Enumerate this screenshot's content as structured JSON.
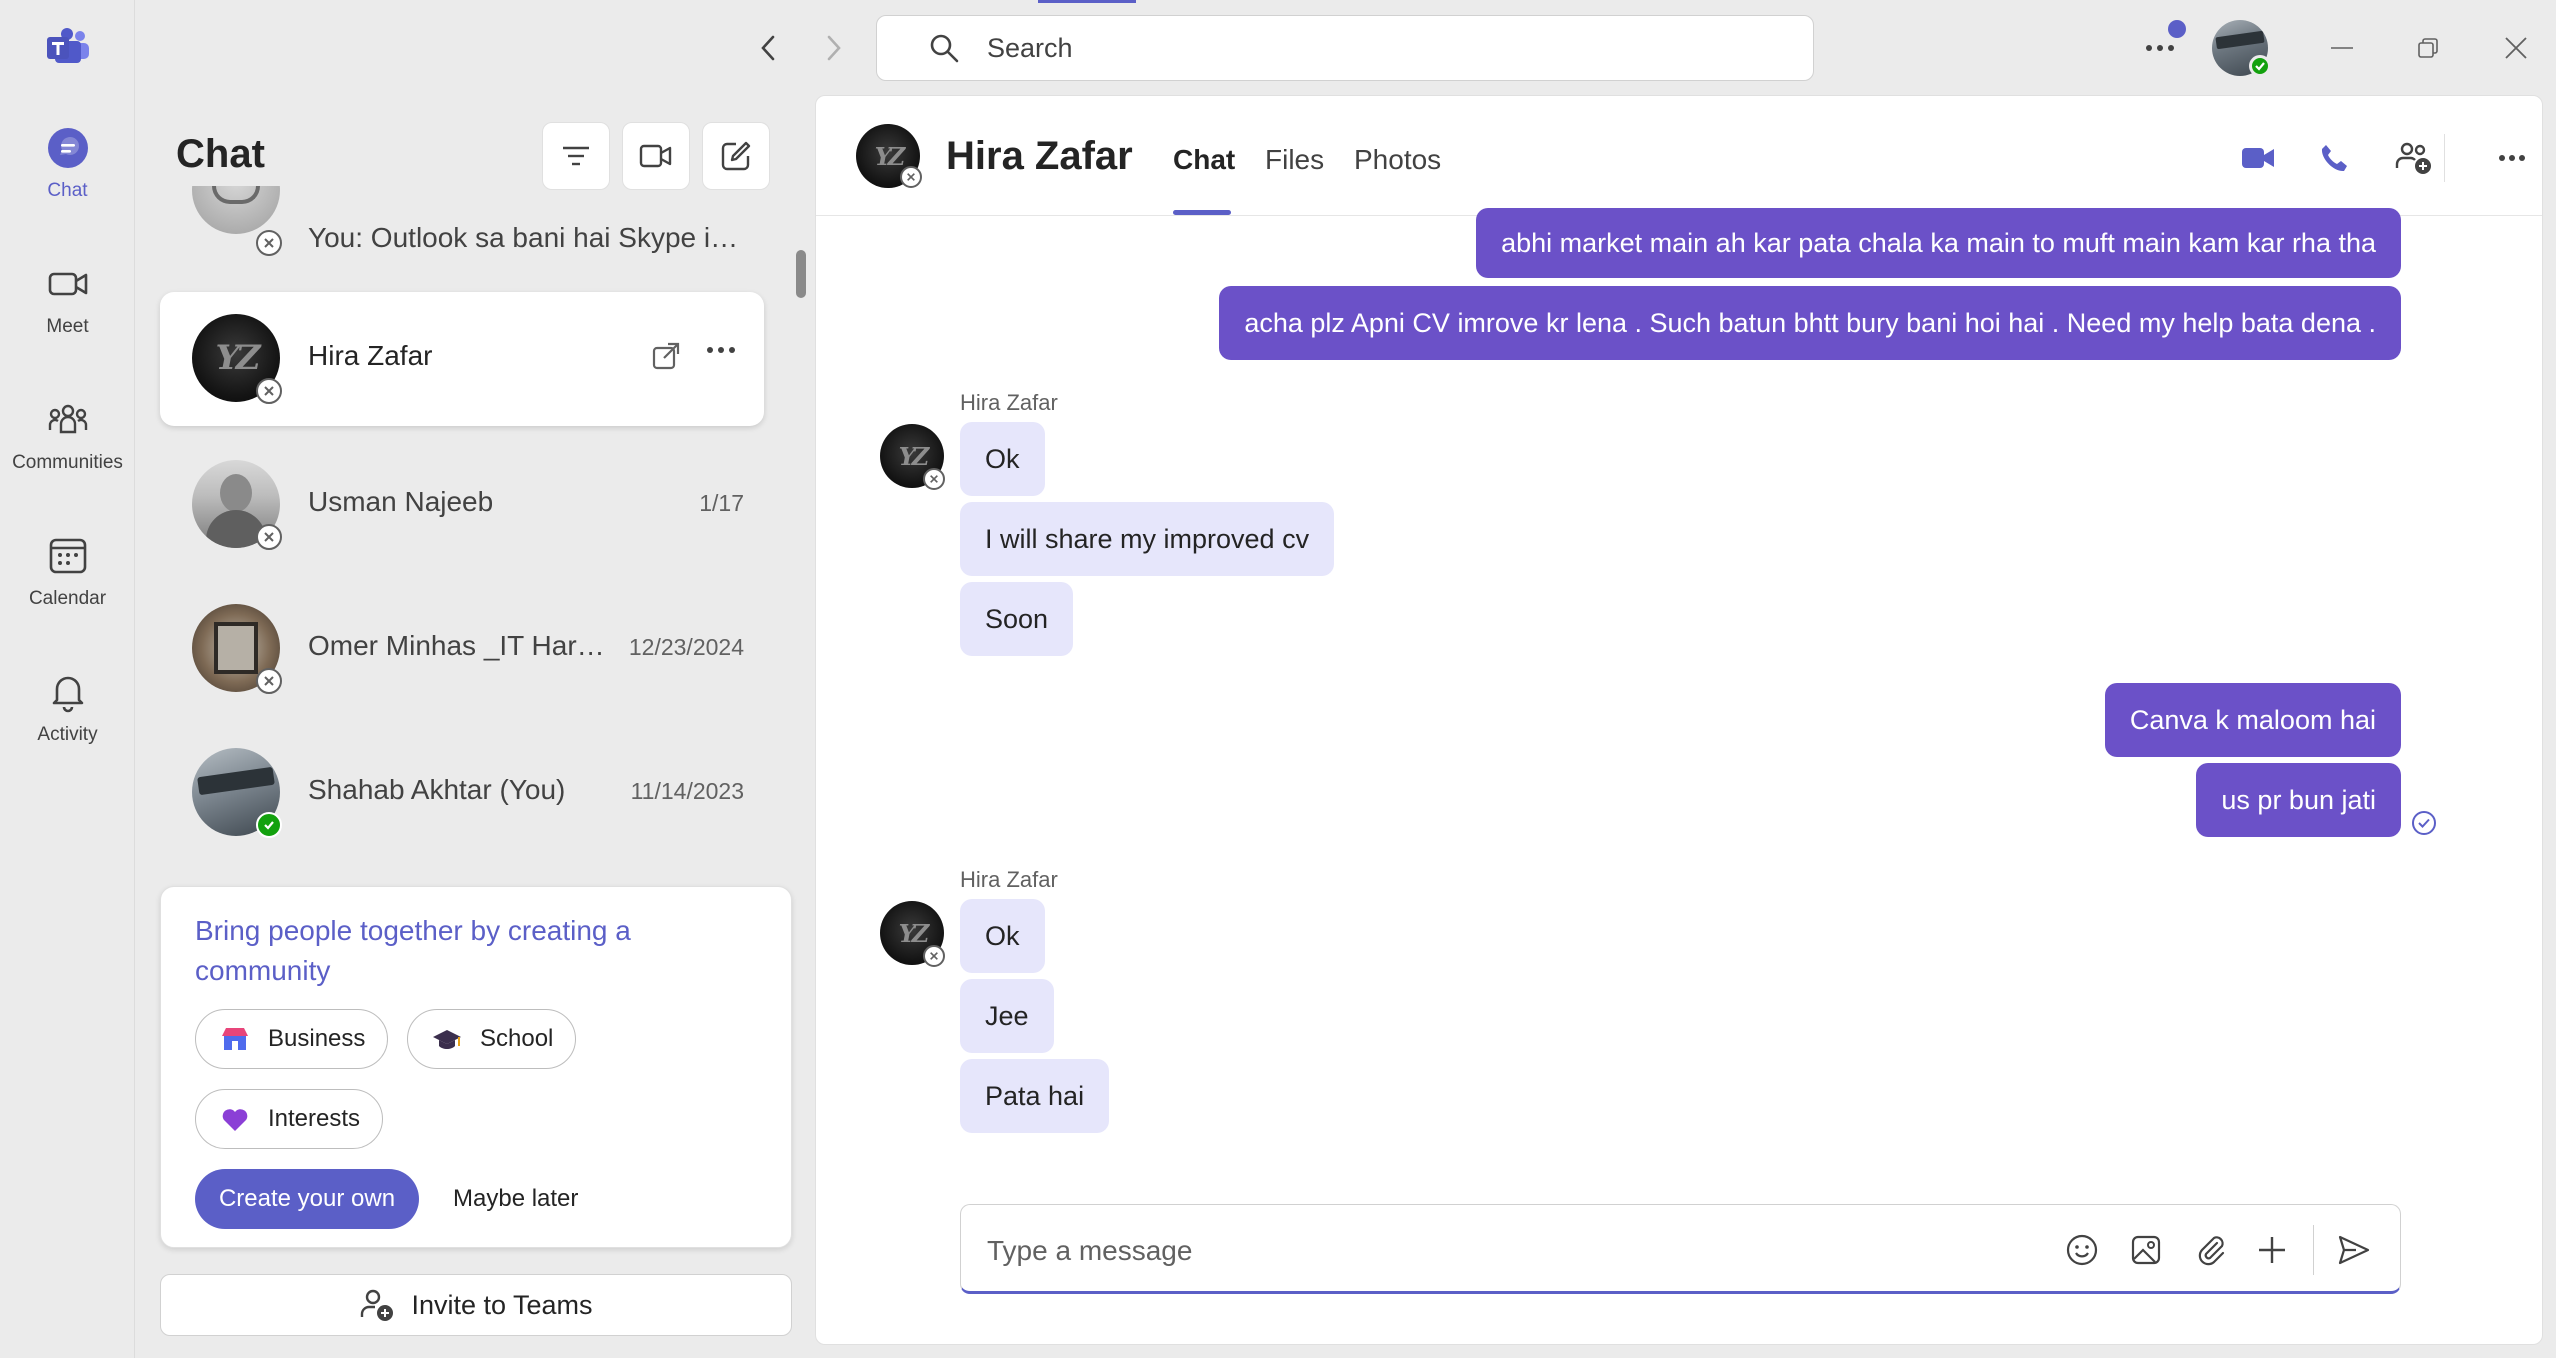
{
  "rail": {
    "items": [
      {
        "label": "Chat",
        "icon": "chat-icon"
      },
      {
        "label": "Meet",
        "icon": "video-camera-icon"
      },
      {
        "label": "Communities",
        "icon": "communities-icon"
      },
      {
        "label": "Calendar",
        "icon": "calendar-icon"
      },
      {
        "label": "Activity",
        "icon": "bell-icon"
      }
    ]
  },
  "search": {
    "placeholder": "Search"
  },
  "chat_list": {
    "title": "Chat",
    "partial_preview": "You: Outlook sa bani hai Skype id ?",
    "rows": [
      {
        "name": "Hira Zafar",
        "date": "",
        "selected": true
      },
      {
        "name": "Usman Najeeb",
        "date": "1/17"
      },
      {
        "name": "Omer Minhas _IT Hard...",
        "date": "12/23/2024"
      },
      {
        "name": "Shahab Akhtar (You)",
        "date": "11/14/2023"
      }
    ]
  },
  "community": {
    "title": "Bring people together by creating a community",
    "options": [
      "Business",
      "School",
      "Interests"
    ],
    "create_label": "Create your own",
    "later_label": "Maybe later"
  },
  "invite_label": "Invite to Teams",
  "conversation": {
    "name": "Hira Zafar",
    "tabs": [
      "Chat",
      "Files",
      "Photos"
    ],
    "messages": [
      {
        "text": "abhi market main ah kar pata chala ka main to muft main kam kar rha tha"
      },
      {
        "text": "acha plz Apni CV imrove kr lena . Such batun bhtt bury bani hoi hai . Need my help bata dena ."
      },
      {
        "sender": "Hira Zafar"
      },
      {
        "text": "Ok"
      },
      {
        "text": "I will share my improved cv"
      },
      {
        "text": "Soon"
      },
      {
        "text": "Canva k maloom hai"
      },
      {
        "text": "us pr bun jati"
      },
      {
        "sender": "Hira Zafar"
      },
      {
        "text": "Ok"
      },
      {
        "text": "Jee"
      },
      {
        "text": "Pata hai"
      }
    ],
    "composer_placeholder": "Type a message"
  },
  "colors": {
    "accent": "#5b5fc7",
    "outgoing_bubble": "#6b51c8",
    "incoming_bubble": "#e6e6fb",
    "online": "#13a10e"
  }
}
